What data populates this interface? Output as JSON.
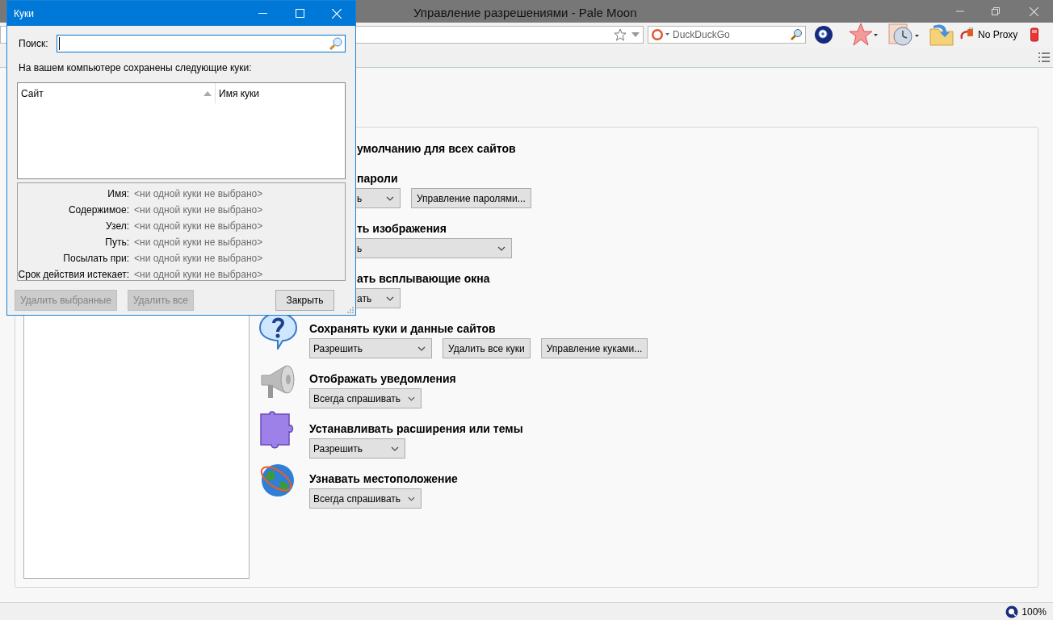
{
  "browser": {
    "title": "Управление разрешениями - Pale Moon",
    "search_placeholder": "DuckDuckGo",
    "proxy_label": "No Proxy"
  },
  "permissions": {
    "heading": "умолчанию для всех сайтов",
    "covered_rows": [
      {
        "title": "пароли",
        "select": "ь",
        "buttons": [
          "Управление паролями..."
        ]
      },
      {
        "title": "ть изображения",
        "select": "ь",
        "buttons": []
      },
      {
        "title": "ать всплывающие окна",
        "select": "ать",
        "buttons": []
      }
    ],
    "rows": [
      {
        "title": "Сохранять куки и данные сайтов",
        "select": "Разрешить",
        "buttons": [
          "Удалить все куки",
          "Управление куками..."
        ]
      },
      {
        "title": "Отображать уведомления",
        "select": "Всегда спрашивать",
        "buttons": []
      },
      {
        "title": "Устанавливать расширения или темы",
        "select": "Разрешить",
        "buttons": []
      },
      {
        "title": "Узнавать местоположение",
        "select": "Всегда спрашивать",
        "buttons": []
      }
    ]
  },
  "dialog": {
    "title": "Куки",
    "search_label": "Поиск:",
    "intro": "На вашем компьютере сохранены следующие куки:",
    "columns": [
      {
        "label": "Сайт",
        "sorted": true
      },
      {
        "label": "Имя куки",
        "sorted": false
      }
    ],
    "details": [
      {
        "label": "Имя:",
        "value": "<ни одной куки не выбрано>"
      },
      {
        "label": "Содержимое:",
        "value": "<ни одной куки не выбрано>"
      },
      {
        "label": "Узел:",
        "value": "<ни одной куки не выбрано>"
      },
      {
        "label": "Путь:",
        "value": "<ни одной куки не выбрано>"
      },
      {
        "label": "Посылать при:",
        "value": "<ни одной куки не выбрано>"
      },
      {
        "label": "Срок действия истекает:",
        "value": "<ни одной куки не выбрано>"
      }
    ],
    "buttons": [
      {
        "label": "Удалить выбранные",
        "disabled": true
      },
      {
        "label": "Удалить все",
        "disabled": true
      },
      {
        "label": "Закрыть",
        "disabled": false
      }
    ]
  },
  "status_bar": {
    "zoom": "100%"
  }
}
